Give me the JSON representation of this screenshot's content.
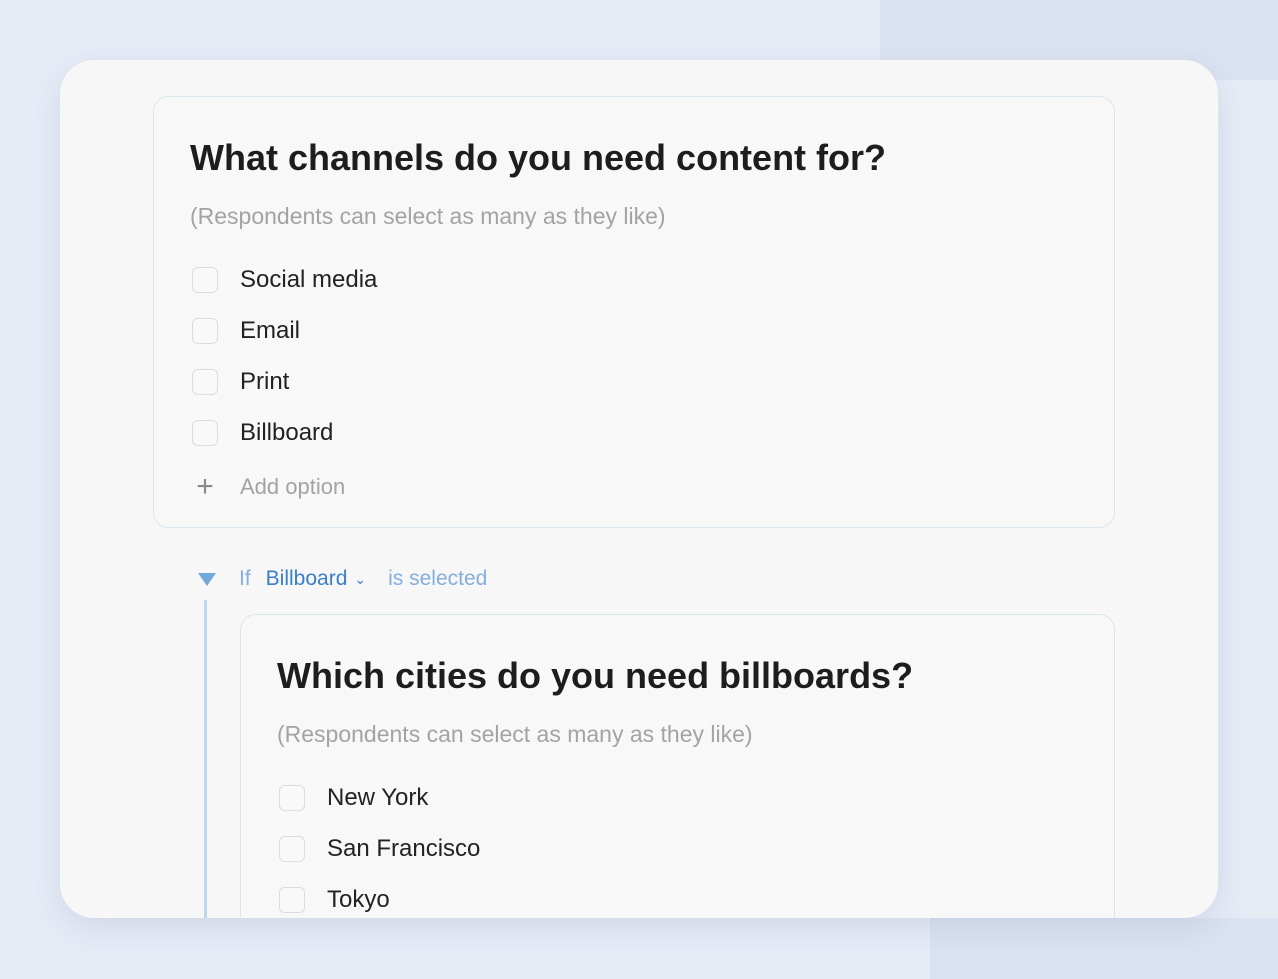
{
  "question1": {
    "title": "What channels do you need content for?",
    "hint": "(Respondents can select as many as they like)",
    "options": [
      "Social media",
      "Email",
      "Print",
      "Billboard"
    ],
    "add_option_label": "Add option",
    "add_icon": "+"
  },
  "condition": {
    "if_label": "If",
    "selected_option": "Billboard",
    "chevron": "⌄",
    "suffix": "is selected"
  },
  "question2": {
    "title": "Which cities do you need billboards?",
    "hint": "(Respondents can select as many as they like)",
    "options": [
      "New York",
      "San Francisco",
      "Tokyo"
    ]
  },
  "colors": {
    "page_background": "#e6ebf6",
    "card_background": "#f7f7f7",
    "accent_blue": "#3a7fc7",
    "light_blue": "#84aede",
    "branch_line": "#bcd8f1"
  }
}
